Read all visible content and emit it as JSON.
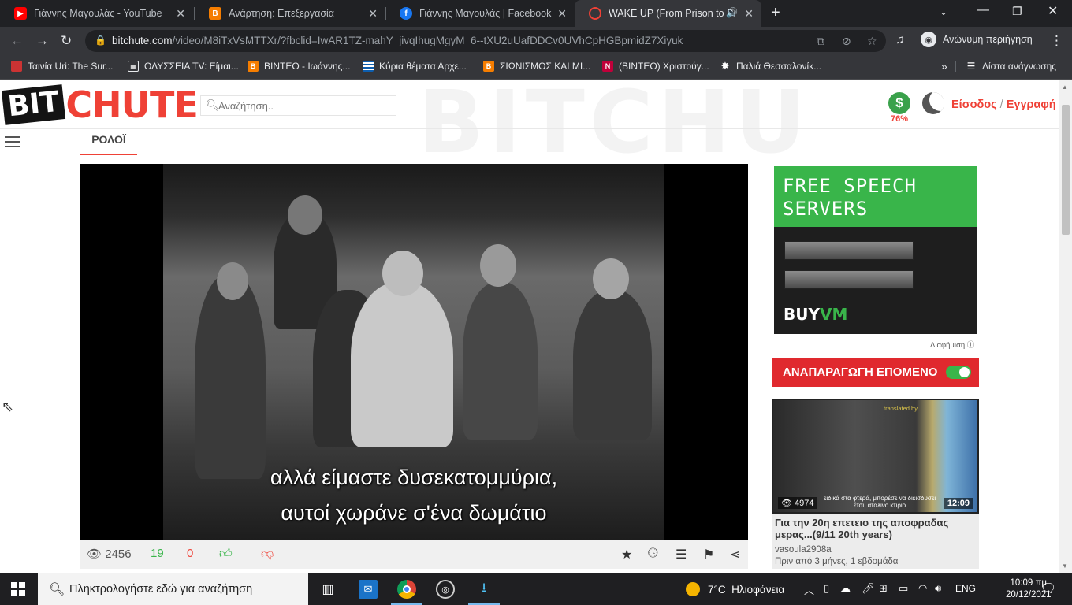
{
  "browser": {
    "tabs": [
      {
        "title": "Γιάννης Μαγουλάς - YouTube",
        "favicon": "youtube-icon",
        "active": false
      },
      {
        "title": "Ανάρτηση: Επεξεργασία",
        "favicon": "blogger-icon",
        "active": false
      },
      {
        "title": "Γιάννης Μαγουλάς | Facebook",
        "favicon": "facebook-icon",
        "active": false
      },
      {
        "title": "WAKE UP (From Prison to Pa",
        "favicon": "bitchute-icon",
        "active": true
      }
    ],
    "url_host": "bitchute.com",
    "url_path": "/video/M8iTxVsMTTXr/?fbclid=IwAR1TZ-mahY_jivqIhugMgyM_6--tXU2uUafDDCv0UVhCpHGBpmidZ7Xiyuk",
    "profile_label": "Ανώνυμη περιήγηση",
    "bookmarks": [
      {
        "label": "Ταινία Uri: The Sur...",
        "icon": "site-icon"
      },
      {
        "label": "ΟΔΥΣΣΕΙΑ TV: Είμαι...",
        "icon": "grid-icon"
      },
      {
        "label": "ΒΙΝΤΕΟ - Ιωάννης...",
        "icon": "blogger-icon"
      },
      {
        "label": "Κύρια θέματα Αρχε...",
        "icon": "greek-flag-icon"
      },
      {
        "label": "ΣΙΩΝΙΣΜΟΣ ΚΑΙ ΜΙ...",
        "icon": "blogger-icon"
      },
      {
        "label": "(ΒΙΝΤΕΟ) Χριστούγ...",
        "icon": "news-icon"
      },
      {
        "label": "Παλιά Θεσσαλονίκ...",
        "icon": "star-icon"
      }
    ],
    "reading_list": "Λίστα ανάγνωσης"
  },
  "site": {
    "logo_bit": "BIT",
    "logo_chute": "CHUTE",
    "search_placeholder": "Αναζήτηση..",
    "donation_percent": "76%",
    "login": "Είσοδος",
    "register": "Εγγραφή",
    "channel_tab": "ΡΟΛΟΪ"
  },
  "video": {
    "subtitle_line1": "αλλά είμαστε δυσεκατομμύρια,",
    "subtitle_line2": "αυτοί χωράνε σ'ένα δωμάτιο",
    "views": "2456",
    "likes": "19",
    "dislikes": "0"
  },
  "ad": {
    "headline": "FREE SPEECH SERVERS",
    "brand_a": "BUY",
    "brand_b": "VM",
    "label": "Διαφήμιση"
  },
  "autoplay": {
    "label": "ΑΝΑΠΑΡΑΓΩΓΗ ΕΠΟΜΕΝΟ",
    "enabled": true
  },
  "related": {
    "views": "4974",
    "duration": "12:09",
    "title": "Για την 20η επετειο της αποφραδας μερας...(9/11 20th years)",
    "author": "vasoula2908a",
    "date": "Πριν από 3 μήνες, 1 εβδομάδα",
    "thumb_caption": "ειδικά στα φτερά, μπορέσε να διεισδυσει έτσι, αταλινο κτιριο",
    "thumb_credit": "translated by"
  },
  "taskbar": {
    "search_placeholder": "Πληκτρολογήστε εδώ για αναζήτηση",
    "weather_temp": "7°C",
    "weather_desc": "Ηλιοφάνεια",
    "language": "ENG",
    "time": "10:09 πμ",
    "date": "20/12/2021"
  },
  "colors": {
    "brand_red": "#ef4136",
    "brand_green": "#39b54a"
  }
}
